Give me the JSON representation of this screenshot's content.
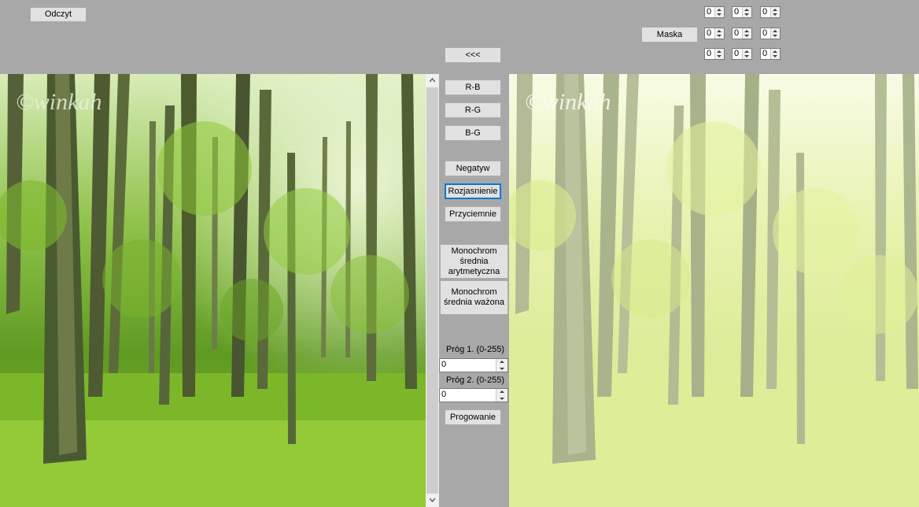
{
  "toolbar": {
    "read_label": "Odczyt",
    "mask_label": "Maska",
    "back_label": "<<<"
  },
  "mask": {
    "rows": [
      [
        "0",
        "0",
        "0"
      ],
      [
        "0",
        "0",
        "0"
      ],
      [
        "0",
        "0",
        "0"
      ]
    ]
  },
  "channels": {
    "rb": "R-B",
    "rg": "R-G",
    "bg": "B-G"
  },
  "ops": {
    "negative": "Negatyw",
    "brighten": "Rozjasnienie",
    "darken": "Przyciemnie",
    "mono_arith_l1": "Monochrom",
    "mono_arith_l2": "średnia",
    "mono_arith_l3": "arytmetyczna",
    "mono_weighted_l1": "Monochrom",
    "mono_weighted_l2": "średnia ważona"
  },
  "threshold": {
    "label1": "Próg 1. (0-255)",
    "value1": "0",
    "label2": "Próg 2. (0-255)",
    "value2": "0",
    "button": "Progowanie"
  },
  "watermark": "©winkah",
  "colors": {
    "panel_bg": "#a8a8a8",
    "button_bg": "#e1e1e1",
    "focus_border": "#0078d7"
  }
}
